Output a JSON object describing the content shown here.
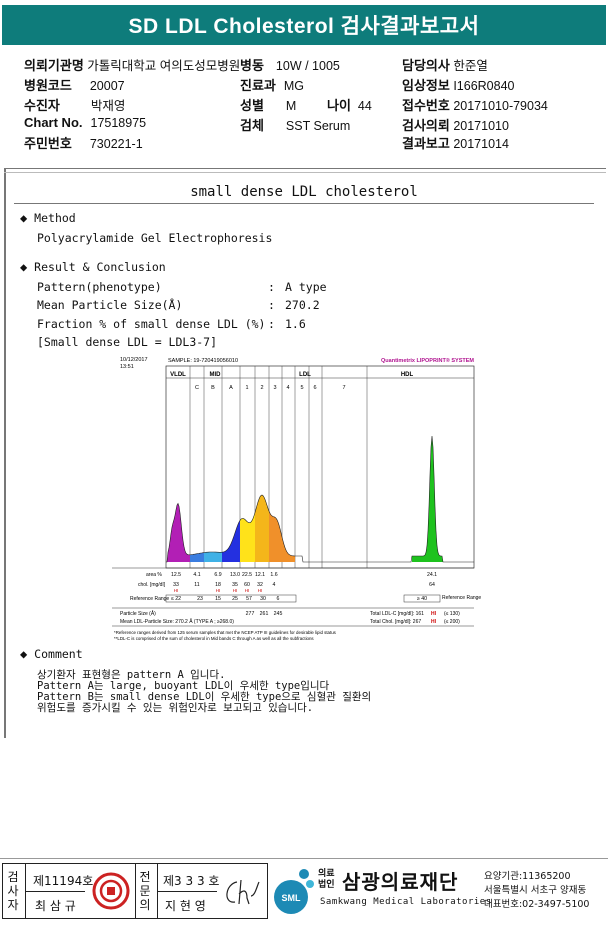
{
  "title": "SD LDL Cholesterol 검사결과보고서",
  "header": {
    "col1": [
      {
        "label": "의뢰기관명",
        "value": "가톨릭대학교 여의도성모병원"
      },
      {
        "label": "병원코드",
        "value": "20007"
      },
      {
        "label": "수진자",
        "value": "박재영"
      },
      {
        "label": "Chart No.",
        "value": "17518975"
      },
      {
        "label": "주민번호",
        "value": "730221-1"
      }
    ],
    "col2": [
      {
        "label": "병동",
        "value": "10W / 1005"
      },
      {
        "label": "진료과",
        "value": "MG"
      },
      {
        "label": "성별",
        "value": "M"
      },
      {
        "label": "검체",
        "value": "SST Serum"
      }
    ],
    "age": {
      "label": "나이",
      "value": "44"
    },
    "col3": [
      {
        "label": "담당의사",
        "value": "한준열"
      },
      {
        "label": "임상정보",
        "value": "I166R0840"
      },
      {
        "label": "접수번호",
        "value": "20171010-79034"
      },
      {
        "label": "검사의뢰",
        "value": "20171010"
      },
      {
        "label": "결과보고",
        "value": "20171014"
      }
    ]
  },
  "report": {
    "section_title": "small dense LDL cholesterol",
    "bullet": "◆",
    "method_heading": "Method",
    "method_text": "Polyacrylamide Gel Electrophoresis",
    "result_heading": "Result & Conclusion",
    "results": [
      {
        "label": "Pattern(phenotype)",
        "sep": ":",
        "value": "A type"
      },
      {
        "label": "Mean Particle Size(Å)",
        "sep": ":",
        "value": "270.2"
      },
      {
        "label": "Fraction % of small dense LDL (%)",
        "sep": ":",
        "value": "1.6"
      }
    ],
    "sd_formula": "[Small dense LDL = LDL3-7]",
    "comment_heading": "Comment",
    "comment_lines": [
      "상기환자 표현형은 pattern A 입니다.",
      "Pattern A는 large, buoyant LDL이 우세한 type입니다",
      "Pattern B는 small dense LDL이 우세한 type으로 심혈관 질환의",
      "위험도를 증가시킬 수 있는 위험인자로 보고되고 있습니다."
    ]
  },
  "chart_data": {
    "type": "area",
    "header_date": "10/12/2017",
    "header_time": "13:51",
    "sample_label": "SAMPLE: 19-720419056010",
    "brand": "Quantimetrix LIPOPRINT® SYSTEM",
    "region_labels": [
      "VLDL",
      "MID",
      "LDL",
      "HDL"
    ],
    "band_labels": [
      "C",
      "B",
      "A",
      "1",
      "2",
      "3",
      "4",
      "5",
      "6",
      "7"
    ],
    "row_area_label": "area %",
    "area_values": [
      "12.5",
      "4.1",
      "6.9",
      "13.0",
      "22.5",
      "12.1",
      "1.6",
      "24.1"
    ],
    "row_chol_label": "chol. [mg/dl]",
    "chol_values": [
      "33",
      "11",
      "18",
      "35",
      "60",
      "32",
      "4",
      "64"
    ],
    "chol_flags": [
      "HI",
      "",
      "HI",
      "HI",
      "HI",
      "HI",
      "",
      ""
    ],
    "ref_label": "Reference Range",
    "ref_values": [
      "≤ 22",
      "23",
      "15",
      "25",
      "57",
      "30",
      "6"
    ],
    "hdl_ref": "≥ 40",
    "particle_label": "Particle Size (Å)",
    "particle_values": [
      "277",
      "261",
      "245"
    ],
    "mean_size_text": "Mean LDL-Particle Size:  270.2 Å  (TYPE A ; ≥268.0)",
    "total_ldl_text": "Total LDL-C [mg/dl]: 161",
    "total_ldl_flag": "HI",
    "total_ldl_ref": "(≤ 130)",
    "total_chol_text": "Total Chol. [mg/dl]: 267",
    "total_chol_flag": "HI",
    "total_chol_ref": "(≤ 200)",
    "ref_row_label": "Reference Range",
    "footnote1": "*Reference ranges derived from 125 serum samples that met the NCEP ATP III guidelines for desirable lipid status",
    "footnote2": "**LDL-C is comprised of the sum of cholesterol in Mid bands C through A as well as all the subfractions",
    "colors": {
      "vldl": "#b21fb5",
      "mid_c": "#3a7de0",
      "mid_b": "#3fb1e6",
      "mid_a": "#2430e0",
      "ldl1": "#ffe21a",
      "ldl2": "#f4b61a",
      "ldl3": "#f0902a",
      "hdl": "#1ec21e"
    }
  },
  "footer": {
    "v1": [
      "검",
      "사",
      "자"
    ],
    "reg1": "제11194호",
    "name1": "최 삼 규",
    "v2": [
      "전",
      "문",
      "의"
    ],
    "reg2": "제3 3 3 호",
    "name2": "지 현 영",
    "logo_mark": "SML",
    "org_small1": "의료",
    "org_small2": "법인",
    "org_name": "삼광의료재단",
    "org_en": "Samkwang Medical Laboratories",
    "code": "요양기관:11365200",
    "address": "서울특별시 서초구 양재동",
    "phone": "대표번호:02-3497-5100"
  }
}
